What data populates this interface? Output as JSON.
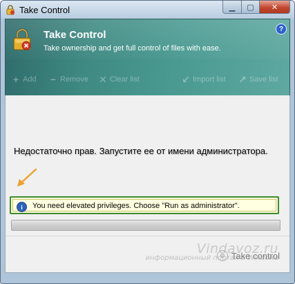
{
  "window": {
    "title": "Take Control"
  },
  "caption_buttons": {
    "minimize_icon": "minimize-icon",
    "maximize_icon": "maximize-icon",
    "close_icon": "close-icon"
  },
  "header": {
    "title": "Take Control",
    "subtitle": "Take ownership and get full control of files with ease.",
    "help_label": "?"
  },
  "toolbar": {
    "add_label": "Add",
    "remove_label": "Remove",
    "clear_list_label": "Clear list",
    "import_list_label": "Import list",
    "save_list_label": "Save list"
  },
  "content": {
    "annotation": "Недостаточно прав. Запустите ее от имени администратора.",
    "info_message": "You need elevated privileges. Choose \"Run as administrator\".",
    "progress_value": 0
  },
  "footer": {
    "take_control_label": "Take control"
  },
  "watermark": {
    "brand": "Vindavoz.ru",
    "subtitle": "информационный портал о Windows"
  },
  "colors": {
    "header_teal": "#3f8a83",
    "info_border_green": "#3d8b2e",
    "info_background": "#ffffe1",
    "annotation_arrow": "#f0a030",
    "close_button_red": "#c2472f"
  }
}
